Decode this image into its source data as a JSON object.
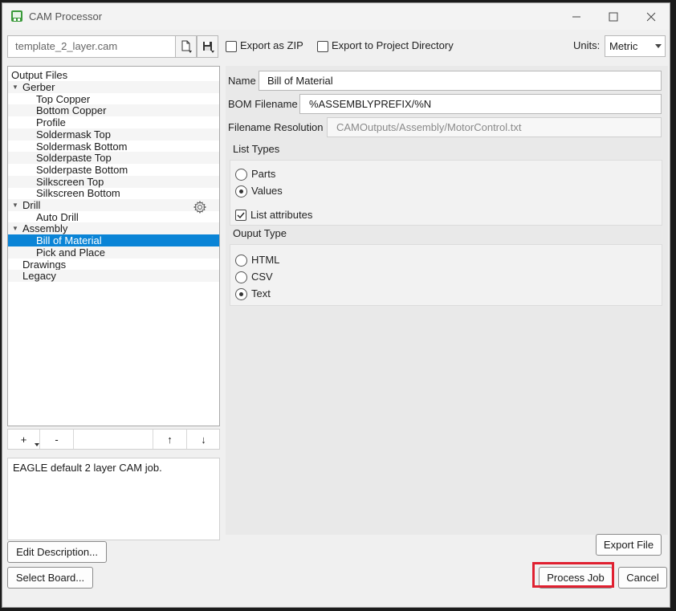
{
  "window": {
    "title": "CAM Processor",
    "minimize_icon": "minimize-icon",
    "maximize_icon": "maximize-icon",
    "close_icon": "close-icon"
  },
  "toolbar": {
    "job_file": "template_2_layer.cam",
    "export_zip_label": "Export as ZIP",
    "export_zip_checked": false,
    "export_project_label": "Export to Project Directory",
    "export_project_checked": false,
    "units_label": "Units:",
    "units_value": "Metric"
  },
  "tree": {
    "root": "Output Files",
    "items": [
      {
        "label": "Gerber",
        "level": 1,
        "expanded": true
      },
      {
        "label": "Top Copper",
        "level": 2
      },
      {
        "label": "Bottom Copper",
        "level": 2
      },
      {
        "label": "Profile",
        "level": 2
      },
      {
        "label": "Soldermask Top",
        "level": 2
      },
      {
        "label": "Soldermask Bottom",
        "level": 2
      },
      {
        "label": "Solderpaste Top",
        "level": 2
      },
      {
        "label": "Solderpaste Bottom",
        "level": 2
      },
      {
        "label": "Silkscreen Top",
        "level": 2
      },
      {
        "label": "Silkscreen Bottom",
        "level": 2
      },
      {
        "label": "Drill",
        "level": 1,
        "expanded": true
      },
      {
        "label": "Auto Drill",
        "level": 2
      },
      {
        "label": "Assembly",
        "level": 1,
        "expanded": true
      },
      {
        "label": "Bill of Material",
        "level": 2,
        "selected": true
      },
      {
        "label": "Pick and Place",
        "level": 2
      },
      {
        "label": "Drawings",
        "level": 1
      },
      {
        "label": "Legacy",
        "level": 1
      }
    ],
    "add_label": "+",
    "remove_label": "-",
    "up_label": "↑",
    "down_label": "↓"
  },
  "description": "EAGLE default 2 layer CAM job.",
  "buttons": {
    "edit_description": "Edit Description...",
    "select_board": "Select Board...",
    "export_file": "Export File",
    "process_job": "Process Job",
    "cancel": "Cancel"
  },
  "form": {
    "name_label": "Name",
    "name_value": "Bill of Material",
    "bom_label": "BOM Filename",
    "bom_value": "%ASSEMBLYPREFIX/%N",
    "resolution_label": "Filename Resolution",
    "resolution_value": "CAMOutputs/Assembly/MotorControl.txt",
    "list_types_label": "List Types",
    "list_types": [
      {
        "label": "Parts",
        "selected": false
      },
      {
        "label": "Values",
        "selected": true
      }
    ],
    "list_attributes_label": "List attributes",
    "list_attributes_checked": true,
    "output_type_label": "Ouput Type",
    "output_types": [
      {
        "label": "HTML",
        "selected": false
      },
      {
        "label": "CSV",
        "selected": false
      },
      {
        "label": "Text",
        "selected": true
      }
    ]
  },
  "colors": {
    "selection": "#0a84d6",
    "highlight": "#e02030"
  }
}
